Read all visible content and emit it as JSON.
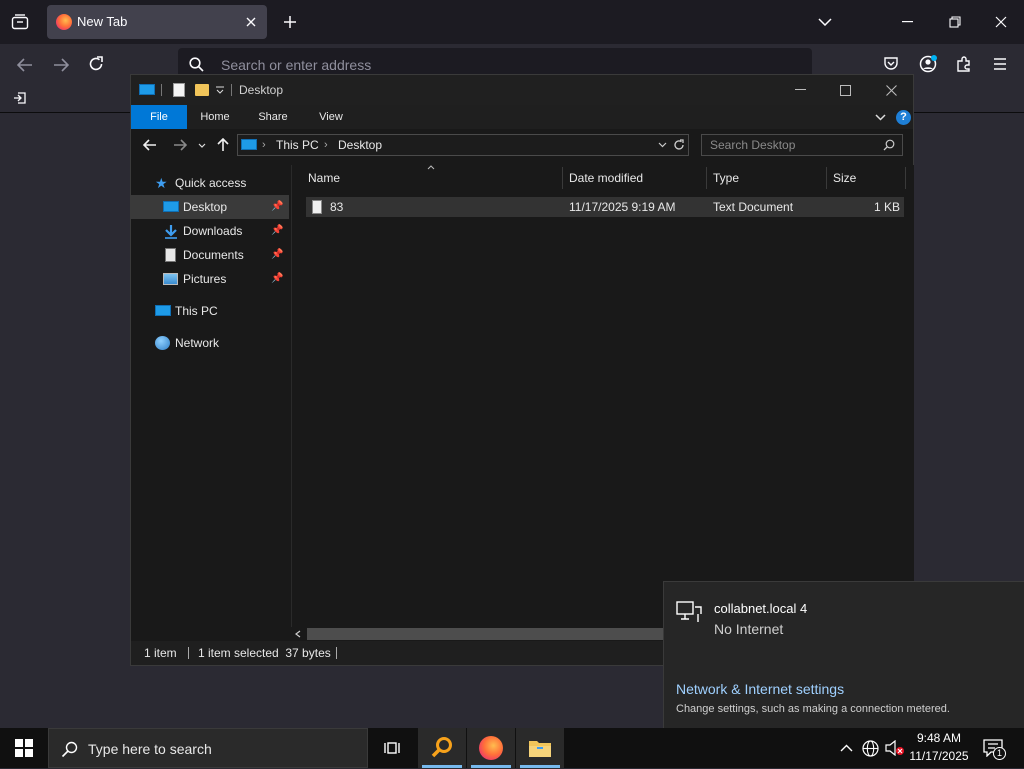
{
  "browser": {
    "tab_title": "New Tab",
    "address_placeholder": "Search or enter address"
  },
  "explorer": {
    "window_title": "Desktop",
    "ribbon_tabs": [
      "File",
      "Home",
      "Share",
      "View"
    ],
    "breadcrumb": [
      "This PC",
      "Desktop"
    ],
    "search_placeholder": "Search Desktop",
    "nav": {
      "quick_access": "Quick access",
      "items": [
        {
          "label": "Desktop",
          "icon": "desktop-folder-icon",
          "pinned": true,
          "selected": true
        },
        {
          "label": "Downloads",
          "icon": "downloads-folder-icon",
          "pinned": true
        },
        {
          "label": "Documents",
          "icon": "documents-folder-icon",
          "pinned": true
        },
        {
          "label": "Pictures",
          "icon": "pictures-folder-icon",
          "pinned": true
        }
      ],
      "this_pc": "This PC",
      "network": "Network"
    },
    "columns": [
      "Name",
      "Date modified",
      "Type",
      "Size"
    ],
    "files": [
      {
        "name": "83",
        "date": "11/17/2025 9:19 AM",
        "type": "Text Document",
        "size": "1 KB"
      }
    ],
    "status": {
      "count": "1 item",
      "selection": "1 item selected  37 bytes"
    }
  },
  "network_flyout": {
    "network_name": "collabnet.local 4",
    "network_status": "No Internet",
    "settings_link": "Network & Internet settings",
    "settings_desc": "Change settings, such as making a connection metered."
  },
  "taskbar": {
    "search_placeholder": "Type here to search",
    "time": "9:48 AM",
    "date": "11/17/2025",
    "notification_count": "1"
  },
  "colors": {
    "accent": "#0078d7",
    "link": "#9fd0ff",
    "selected_row": "#333333"
  }
}
